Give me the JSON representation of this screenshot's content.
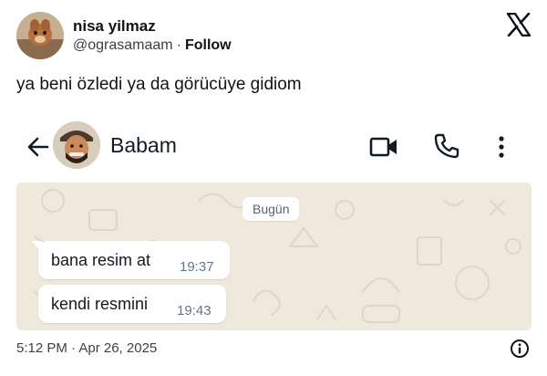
{
  "tweet": {
    "author_name": "nisa yilmaz",
    "handle": "@ograsamaam",
    "separator": "·",
    "follow_label": "Follow",
    "text": "ya beni özledi ya da görücüye gidiom",
    "timestamp": "5:12 PM · Apr 26, 2025"
  },
  "whatsapp": {
    "contact_name": "Babam",
    "date_label": "Bugün",
    "messages": [
      {
        "text": "bana resim at",
        "time": "19:37"
      },
      {
        "text": "kendi resmini",
        "time": "19:43"
      }
    ]
  },
  "icons": {
    "brand": "x-logo-icon",
    "back": "arrow-left-icon",
    "video": "video-camera-icon",
    "call": "phone-icon",
    "more": "more-vertical-icon",
    "info": "info-icon"
  },
  "colors": {
    "chat_background": "#efe8dc",
    "bubble": "#ffffff",
    "text_primary": "#0f1419",
    "text_secondary": "#3c4145",
    "time_text": "#667781"
  }
}
